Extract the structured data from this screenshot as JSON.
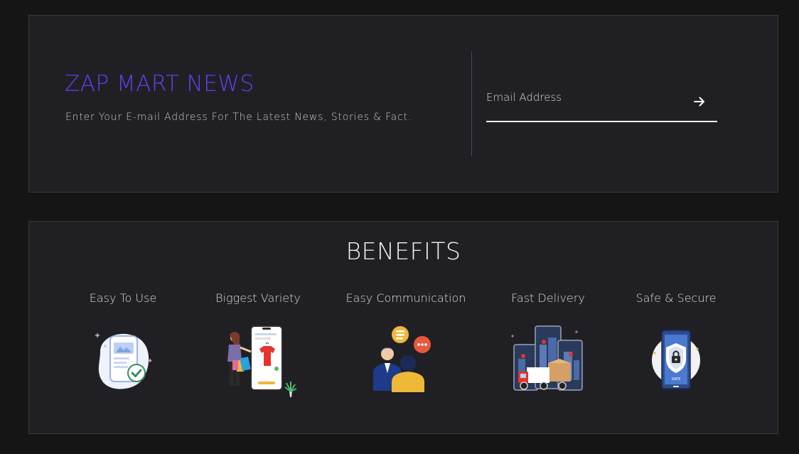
{
  "newsletter": {
    "title": "ZAP MART NEWS",
    "subtitle": "Enter Your E-mail Address For The Latest News, Stories & Fact.",
    "email_placeholder": "Email Address",
    "submit_icon": "arrow-right-icon",
    "title_color": "#6a3cf0"
  },
  "benefits": {
    "title": "BENEFITS",
    "items": [
      {
        "label": "Easy To Use",
        "icon": "phone-check-icon"
      },
      {
        "label": "Biggest Variety",
        "icon": "shopping-variety-icon"
      },
      {
        "label": "Easy Communication",
        "icon": "chat-people-icon"
      },
      {
        "label": "Fast Delivery",
        "icon": "delivery-truck-icon"
      },
      {
        "label": "Safe & Secure",
        "icon": "secure-phone-icon"
      }
    ]
  }
}
